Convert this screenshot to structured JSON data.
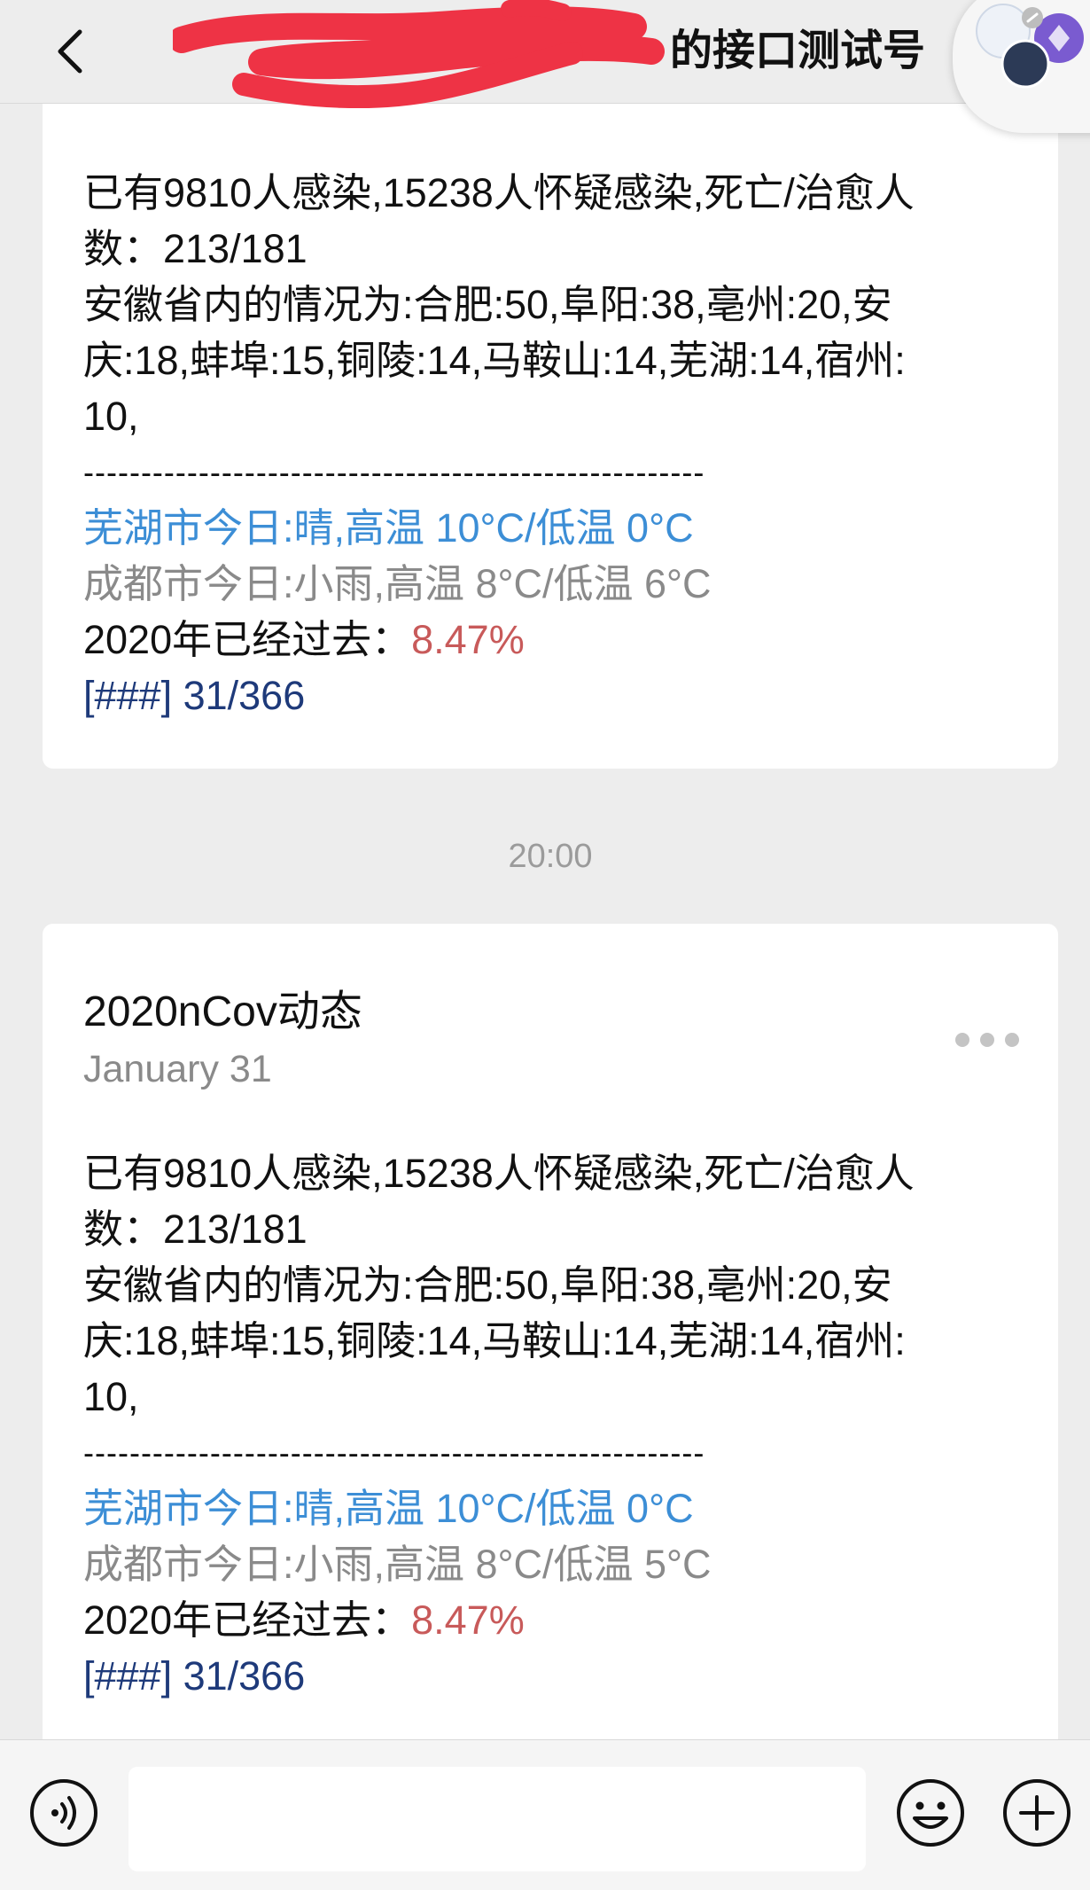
{
  "header": {
    "title": "的接口测试号"
  },
  "timestamp": "20:00",
  "cards": [
    {
      "lines": [
        "已有9810人感染,15238人怀疑感染,死亡/治愈人",
        "数：213/181",
        "安徽省内的情况为:合肥:50,阜阳:38,亳州:20,安",
        "庆:18,蚌埠:15,铜陵:14,马鞍山:14,芜湖:14,宿州:",
        "10,",
        "------------------------------------------------------"
      ],
      "weather_wuhu": "芜湖市今日:晴,高温 10°C/低温 0°C",
      "weather_chengdu": "成都市今日:小雨,高温 8°C/低温 6°C",
      "year_passed_label": "2020年已经过去：",
      "year_passed_value": "8.47%",
      "progress_bar": "[###",
      "progress_count": "] 31/366"
    },
    {
      "title": "2020nCov动态",
      "date": "January 31",
      "lines": [
        "已有9810人感染,15238人怀疑感染,死亡/治愈人",
        "数：213/181",
        "安徽省内的情况为:合肥:50,阜阳:38,亳州:20,安",
        "庆:18,蚌埠:15,铜陵:14,马鞍山:14,芜湖:14,宿州:",
        "10,",
        "------------------------------------------------------"
      ],
      "weather_wuhu": "芜湖市今日:晴,高温 10°C/低温 0°C",
      "weather_chengdu": "成都市今日:小雨,高温 8°C/低温 5°C",
      "year_passed_label": "2020年已经过去：",
      "year_passed_value": "8.47%",
      "progress_bar": "[###",
      "progress_count": "] 31/366"
    }
  ],
  "input": {
    "value": ""
  },
  "icons": {
    "back": "chevron-left-icon",
    "more": "more-dots-icon",
    "voice": "voice-icon",
    "emoji": "emoji-icon",
    "plus": "plus-icon"
  },
  "colors": {
    "background": "#ededed",
    "card": "#ffffff",
    "weather_wuhu": "#3c8ed6",
    "weather_chengdu": "#8a8a8a",
    "percent": "#c85a5a",
    "progress": "#1e3a7a"
  }
}
